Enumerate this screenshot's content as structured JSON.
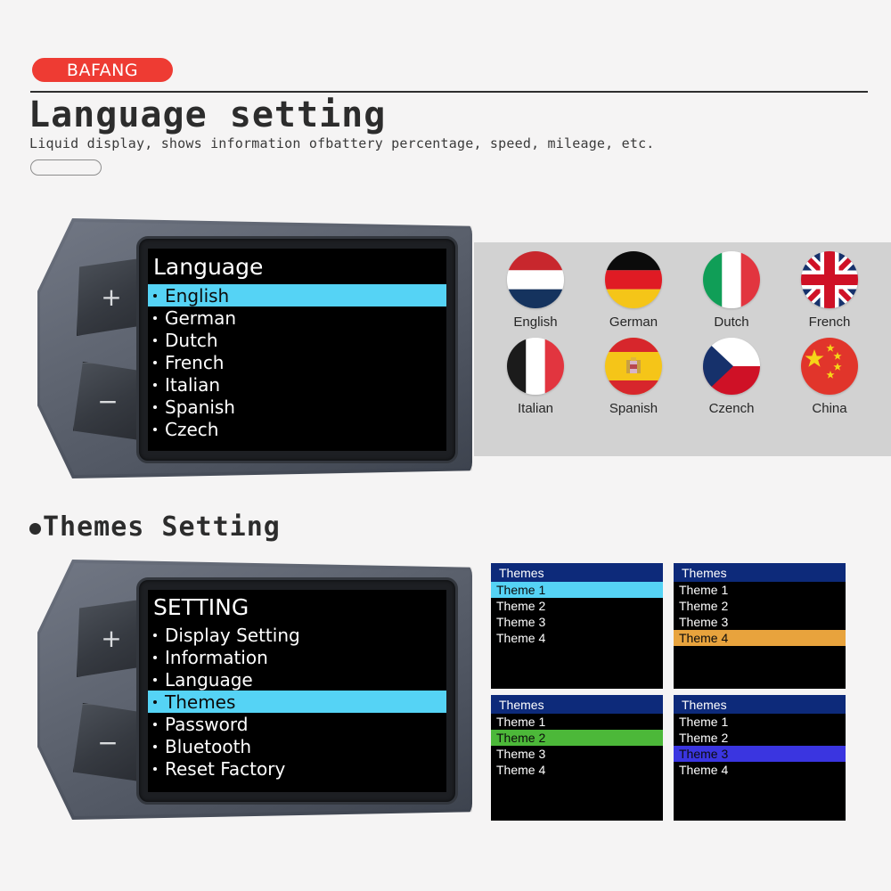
{
  "header": {
    "brand": "BAFANG",
    "title": "Language  setting",
    "subtitle": "Liquid display, shows information ofbattery percentage, speed, mileage, etc."
  },
  "section2": {
    "title": "Themes  Setting"
  },
  "device_top": {
    "button_plus": "+",
    "button_minus": "−",
    "power_icon": "power-icon",
    "lcd": {
      "title": "Language",
      "items": [
        {
          "label": "English",
          "selected": true
        },
        {
          "label": "German",
          "selected": false
        },
        {
          "label": "Dutch",
          "selected": false
        },
        {
          "label": "French",
          "selected": false
        },
        {
          "label": "Italian",
          "selected": false
        },
        {
          "label": "Spanish",
          "selected": false
        },
        {
          "label": "Czech",
          "selected": false
        }
      ]
    }
  },
  "device_bottom": {
    "button_plus": "+",
    "button_minus": "−",
    "power_icon": "power-icon",
    "lcd": {
      "title": "SETTING",
      "items": [
        {
          "label": "Display Setting",
          "selected": false
        },
        {
          "label": "Information",
          "selected": false
        },
        {
          "label": "Language",
          "selected": false
        },
        {
          "label": "Themes",
          "selected": true
        },
        {
          "label": "Password",
          "selected": false
        },
        {
          "label": "Bluetooth",
          "selected": false
        },
        {
          "label": "Reset Factory",
          "selected": false
        }
      ]
    }
  },
  "flags": {
    "items": [
      {
        "label": "English",
        "flag": "netherlands-flag-icon"
      },
      {
        "label": "German",
        "flag": "germany-flag-icon"
      },
      {
        "label": "Dutch",
        "flag": "italy-flag-icon"
      },
      {
        "label": "French",
        "flag": "united-kingdom-flag-icon"
      },
      {
        "label": "Italian",
        "flag": "france-flag-icon"
      },
      {
        "label": "Spanish",
        "flag": "spain-flag-icon"
      },
      {
        "label": "Czench",
        "flag": "czech-republic-flag-icon"
      },
      {
        "label": "China",
        "flag": "china-flag-icon"
      }
    ]
  },
  "themes": {
    "panels": [
      {
        "header": "Themes",
        "highlight_color": "#55d3f5",
        "items": [
          {
            "label": "Theme 1",
            "selected": true
          },
          {
            "label": "Theme 2",
            "selected": false
          },
          {
            "label": "Theme 3",
            "selected": false
          },
          {
            "label": "Theme 4",
            "selected": false
          }
        ]
      },
      {
        "header": "Themes",
        "highlight_color": "#e8a33d",
        "items": [
          {
            "label": "Theme 1",
            "selected": false
          },
          {
            "label": "Theme 2",
            "selected": false
          },
          {
            "label": "Theme 3",
            "selected": false
          },
          {
            "label": "Theme 4",
            "selected": true
          }
        ]
      },
      {
        "header": "Themes",
        "highlight_color": "#4cb839",
        "items": [
          {
            "label": "Theme 1",
            "selected": false
          },
          {
            "label": "Theme 2",
            "selected": true
          },
          {
            "label": "Theme 3",
            "selected": false
          },
          {
            "label": "Theme 4",
            "selected": false
          }
        ]
      },
      {
        "header": "Themes",
        "highlight_color": "#3a35e0",
        "items": [
          {
            "label": "Theme 1",
            "selected": false
          },
          {
            "label": "Theme 2",
            "selected": false
          },
          {
            "label": "Theme 3",
            "selected": true
          },
          {
            "label": "Theme 4",
            "selected": false
          }
        ]
      }
    ]
  },
  "colors": {
    "brand_red": "#ee3b33",
    "page_bg": "#f5f4f4",
    "flag_panel_bg": "#d2d2d2",
    "lcd_highlight": "#55d3f5",
    "theme_header_blue": "#0d2a7a"
  }
}
